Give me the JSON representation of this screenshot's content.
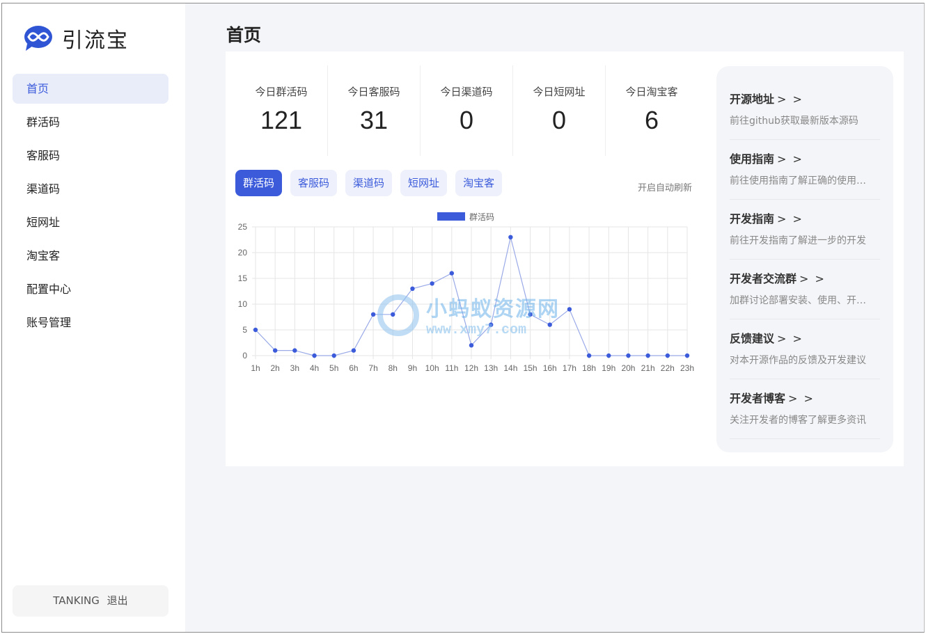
{
  "brand": {
    "name": "引流宝",
    "accent": "#3b5bdb"
  },
  "page": {
    "title": "首页"
  },
  "sidebar": {
    "items": [
      {
        "label": "首页",
        "active": true
      },
      {
        "label": "群活码"
      },
      {
        "label": "客服码"
      },
      {
        "label": "渠道码"
      },
      {
        "label": "短网址"
      },
      {
        "label": "淘宝客"
      },
      {
        "label": "配置中心"
      },
      {
        "label": "账号管理"
      }
    ],
    "user": "TANKING",
    "logout": "退出"
  },
  "stats": [
    {
      "label": "今日群活码",
      "value": "121"
    },
    {
      "label": "今日客服码",
      "value": "31"
    },
    {
      "label": "今日渠道码",
      "value": "0"
    },
    {
      "label": "今日短网址",
      "value": "0"
    },
    {
      "label": "今日淘宝客",
      "value": "6"
    }
  ],
  "tabs": [
    {
      "label": "群活码",
      "active": true
    },
    {
      "label": "客服码"
    },
    {
      "label": "渠道码"
    },
    {
      "label": "短网址"
    },
    {
      "label": "淘宝客"
    }
  ],
  "refresh_label": "开启自动刷新",
  "chart_data": {
    "type": "line",
    "categories": [
      "1h",
      "2h",
      "3h",
      "4h",
      "5h",
      "6h",
      "7h",
      "8h",
      "9h",
      "10h",
      "11h",
      "12h",
      "13h",
      "14h",
      "15h",
      "16h",
      "17h",
      "18h",
      "19h",
      "20h",
      "21h",
      "22h",
      "23h"
    ],
    "series": [
      {
        "name": "群活码",
        "values": [
          5,
          1,
          1,
          0,
          0,
          1,
          8,
          8,
          13,
          14,
          16,
          2,
          6,
          23,
          8,
          6,
          9,
          0,
          0,
          0,
          0,
          0,
          0
        ],
        "color": "#3b5bdb"
      }
    ],
    "ylim": [
      0,
      25
    ],
    "yticks": [
      0,
      5,
      10,
      15,
      20,
      25
    ],
    "grid": true,
    "legend": "top-center"
  },
  "watermark": {
    "line1": "小蚂蚁资源网",
    "line2": "www.xmy7.com"
  },
  "links": [
    {
      "title": "开源地址",
      "arrow": "> >",
      "desc": "前往github获取最新版本源码"
    },
    {
      "title": "使用指南",
      "arrow": "> >",
      "desc": "前往使用指南了解正确的使用方法"
    },
    {
      "title": "开发指南",
      "arrow": "> >",
      "desc": "前往开发指南了解进一步的开发"
    },
    {
      "title": "开发者交流群",
      "arrow": "> >",
      "desc": "加群讨论部署安装、使用、开发等问题"
    },
    {
      "title": "反馈建议",
      "arrow": "> >",
      "desc": "对本开源作品的反馈及开发建议"
    },
    {
      "title": "开发者博客",
      "arrow": "> >",
      "desc": "关注开发者的博客了解更多资讯"
    }
  ]
}
